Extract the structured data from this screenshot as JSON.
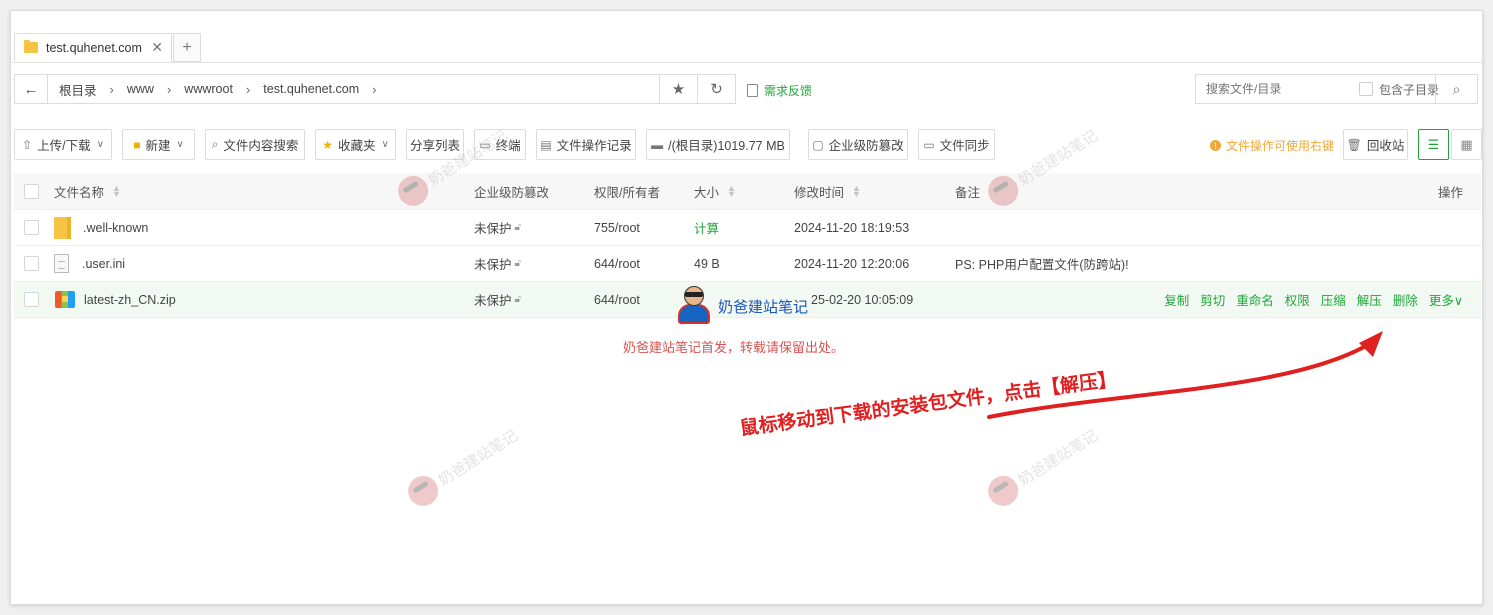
{
  "tab": {
    "title": "test.quhenet.com",
    "close": "✕",
    "new": "+"
  },
  "address": {
    "back": "←",
    "crumbs": [
      "根目录",
      "www",
      "wwwroot",
      "test.quhenet.com"
    ],
    "star": "★",
    "refresh": "↻"
  },
  "feedback": "需求反馈",
  "search": {
    "placeholder": "搜索文件/目录",
    "include_sub": "包含子目录",
    "button": "⌕"
  },
  "toolbar": {
    "upload": "上传/下载",
    "new": "新建",
    "content_search": "文件内容搜索",
    "favorites": "收藏夹",
    "share_list": "分享列表",
    "terminal": "终端",
    "op_log": "文件操作记录",
    "disk": "/(根目录)1019.77 MB",
    "tamper": "企业级防篡改",
    "sync": "文件同步",
    "hint": "文件操作可使用右键",
    "recycle": "回收站"
  },
  "table": {
    "headers": {
      "name": "文件名称",
      "protect": "企业级防篡改",
      "perm": "权限/所有者",
      "size": "大小",
      "time": "修改时间",
      "note": "备注",
      "ops": "操作"
    },
    "rows": [
      {
        "name": ".well-known",
        "protect": "未保护",
        "perm": "755/root",
        "size": "计算",
        "time": "2024-11-20 18:19:53",
        "note": ""
      },
      {
        "name": ".user.ini",
        "protect": "未保护",
        "perm": "644/root",
        "size": "49 B",
        "time": "2024-11-20 12:20:06",
        "note": "PS: PHP用户配置文件(防跨站)!"
      },
      {
        "name": "latest-zh_CN.zip",
        "protect": "未保护",
        "perm": "644/root",
        "size": "",
        "time": "25-02-20 10:05:09",
        "note": ""
      }
    ],
    "ops": [
      "复制",
      "剪切",
      "重命名",
      "权限",
      "压缩",
      "解压",
      "删除",
      "更多"
    ]
  },
  "annotations": {
    "notice": "奶爸建站笔记首发，转载请保留出处。",
    "callout": "鼠标移动到下载的安装包文件，点击【解压】",
    "watermark": "奶爸建站笔记"
  },
  "colors": {
    "accent": "#20a53a",
    "warning": "#f0a838",
    "annotation": "#e02020"
  }
}
